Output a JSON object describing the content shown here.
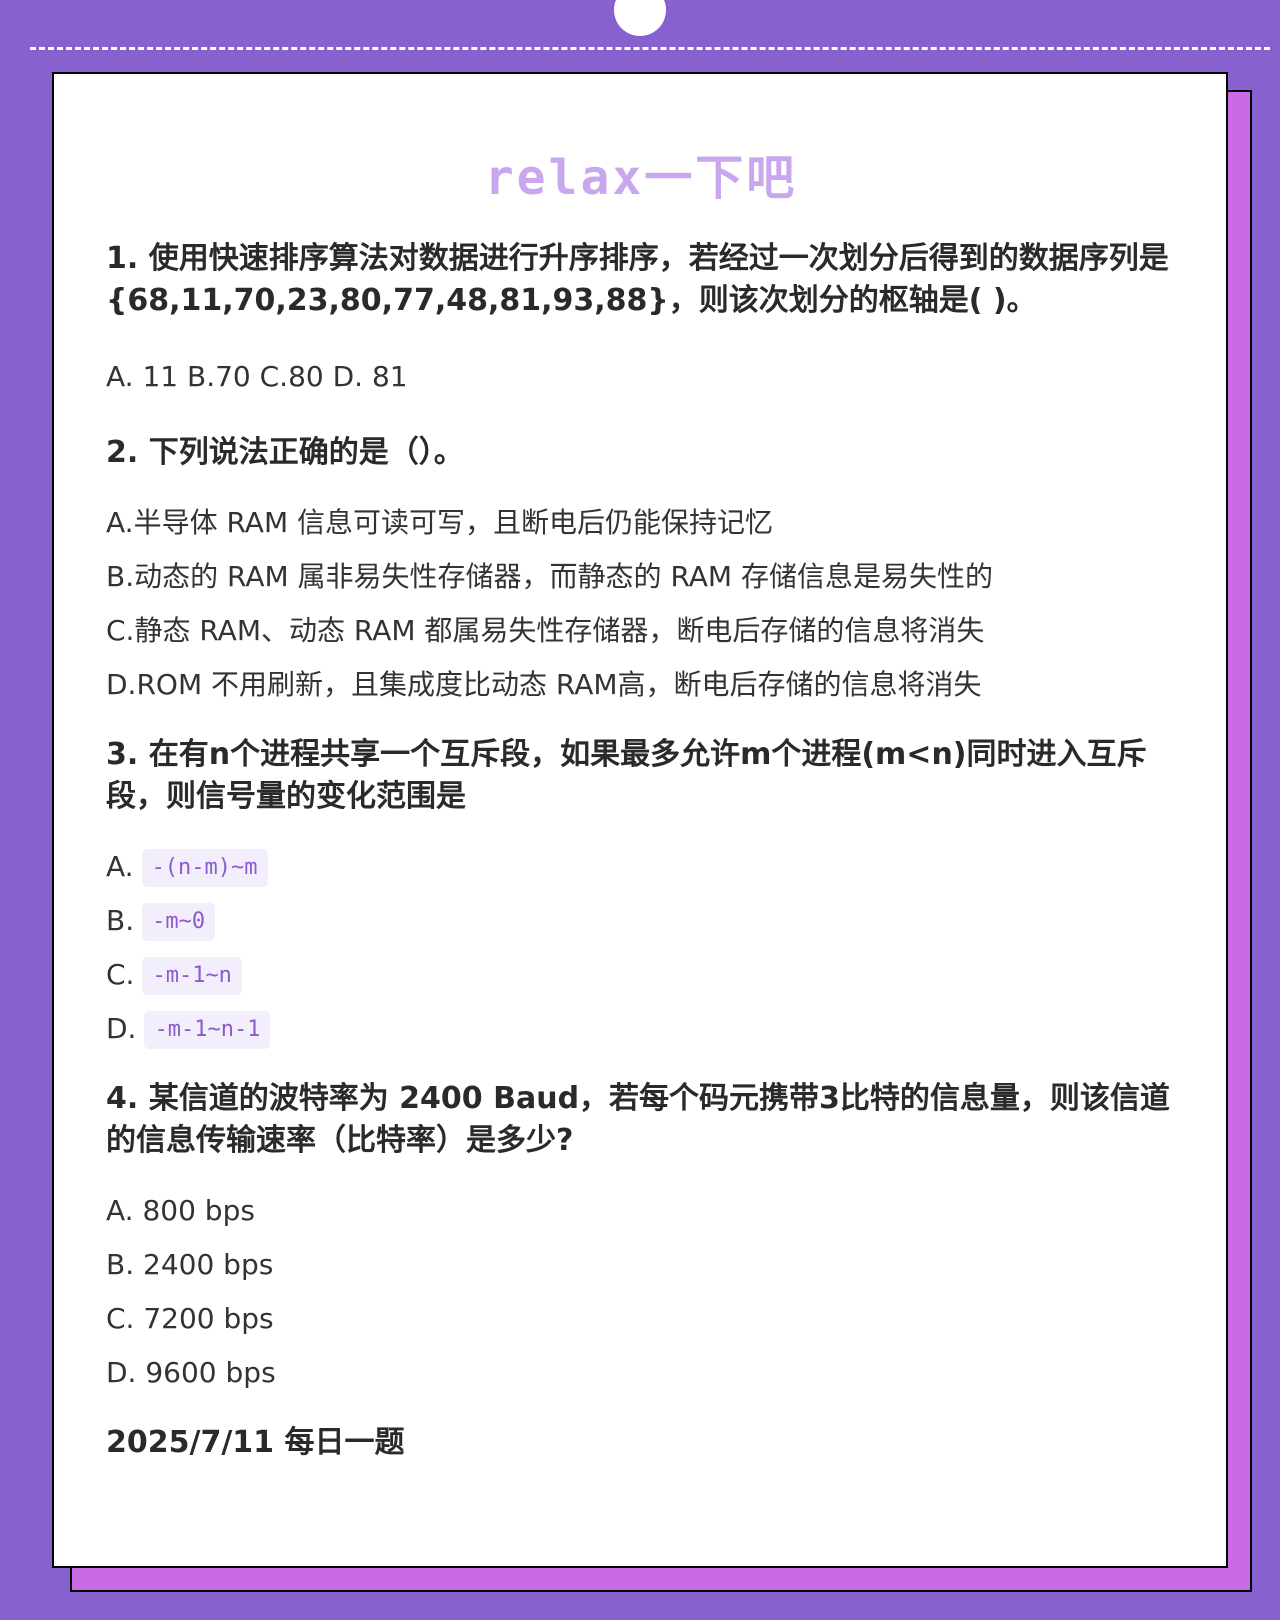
{
  "title": "relax一下吧",
  "questions": [
    {
      "text": "1. 使用快速排序算法对数据进行升序排序，若经过一次划分后得到的数据序列是 {68,11,70,23,80,77,48,81,93,88}，则该次划分的枢轴是( )。",
      "options_line": "A. 11 B.70 C.80 D. 81"
    },
    {
      "text": "2. 下列说法正确的是（）。",
      "options": [
        "A.半导体 RAM 信息可读可写，且断电后仍能保持记忆",
        "B.动态的 RAM 属非易失性存储器，而静态的 RAM 存储信息是易失性的",
        "C.静态 RAM、动态 RAM 都属易失性存储器，断电后存储的信息将消失",
        "D.ROM 不用刷新，且集成度比动态 RAM高，断电后存储的信息将消失"
      ]
    },
    {
      "text": "3. 在有n个进程共享一个互斥段，如果最多允许m个进程(m<n)同时进入互斥段，则信号量的变化范围是",
      "options": [
        {
          "prefix": "A.",
          "code": "-(n-m)~m"
        },
        {
          "prefix": "B.",
          "code": "-m~0"
        },
        {
          "prefix": "C.",
          "code": "-m-1~n"
        },
        {
          "prefix": "D.",
          "code": "-m-1~n-1"
        }
      ]
    },
    {
      "text": "4. 某信道的波特率为 2400 Baud，若每个码元携带3比特的信息量，则该信道的信息传输速率（比特率）是多少?",
      "options": [
        "A. 800 bps",
        "B. 2400 bps",
        "C. 7200 bps",
        "D. 9600 bps"
      ]
    }
  ],
  "footer": "2025/7/11 每日一题",
  "colors": {
    "background": "#8762cf",
    "shadow_card": "#c96ae6",
    "title": "#c9a7ee",
    "code_text": "#8d5ad0",
    "code_bg": "#f3eefb"
  }
}
